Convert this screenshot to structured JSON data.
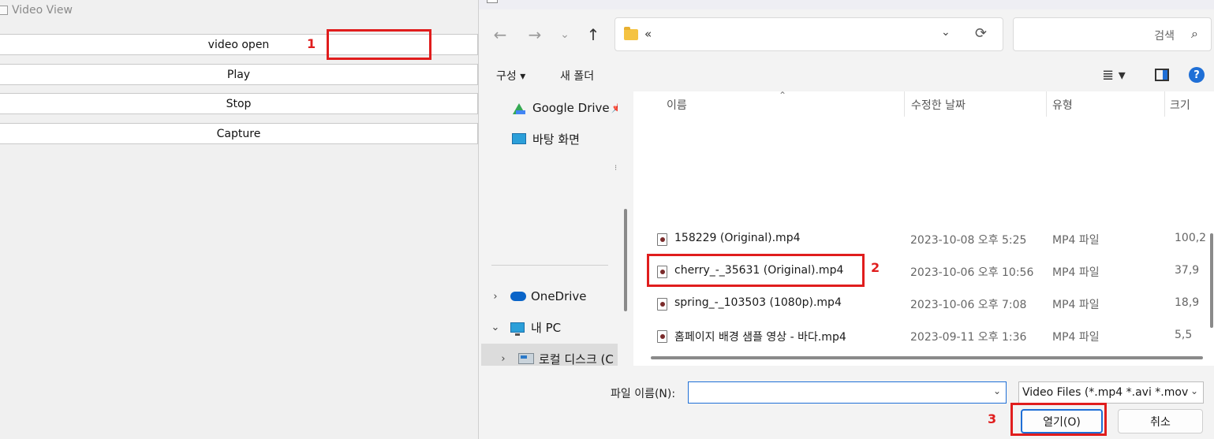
{
  "left_window": {
    "title": "Video View",
    "buttons": [
      "video open",
      "Play",
      "Stop",
      "Capture"
    ]
  },
  "annotations": [
    "1",
    "2",
    "3"
  ],
  "dialog": {
    "address": {
      "crumb": "«",
      "dropdown_glyph": "⌄",
      "refresh_glyph": "⟳"
    },
    "search": {
      "placeholder": "검색",
      "icon": "search-icon"
    },
    "toolbar": {
      "organize": "구성 ▾",
      "new_folder": "새 폴더",
      "view_glyph": "≣ ▾",
      "help": "?"
    },
    "nav": {
      "google_drive": "Google Drive",
      "desktop": "바탕 화면",
      "onedrive": "OneDrive",
      "this_pc": "내 PC",
      "local_disk": "로컬 디스크 (C"
    },
    "columns": {
      "name": "이름",
      "modified": "수정한 날짜",
      "type": "유형",
      "size": "크기"
    },
    "files": [
      {
        "name": "158229 (Original).mp4",
        "date": "2023-10-08 오후 5:25",
        "type": "MP4 파일",
        "size": "100,2"
      },
      {
        "name": "cherry_-_35631 (Original).mp4",
        "date": "2023-10-06 오후 10:56",
        "type": "MP4 파일",
        "size": "37,9"
      },
      {
        "name": "spring_-_103503 (1080p).mp4",
        "date": "2023-10-06 오후 7:08",
        "type": "MP4 파일",
        "size": "18,9"
      },
      {
        "name": "홈페이지 배경 샘플 영상 - 바다.mp4",
        "date": "2023-09-11 오후 1:36",
        "type": "MP4 파일",
        "size": "5,5"
      }
    ],
    "filename_label": "파일 이름(N):",
    "filename_value": "",
    "filetype": "Video Files (*.mp4 *.avi *.mov *",
    "open_button": "열기(O)",
    "cancel_button": "취소"
  }
}
